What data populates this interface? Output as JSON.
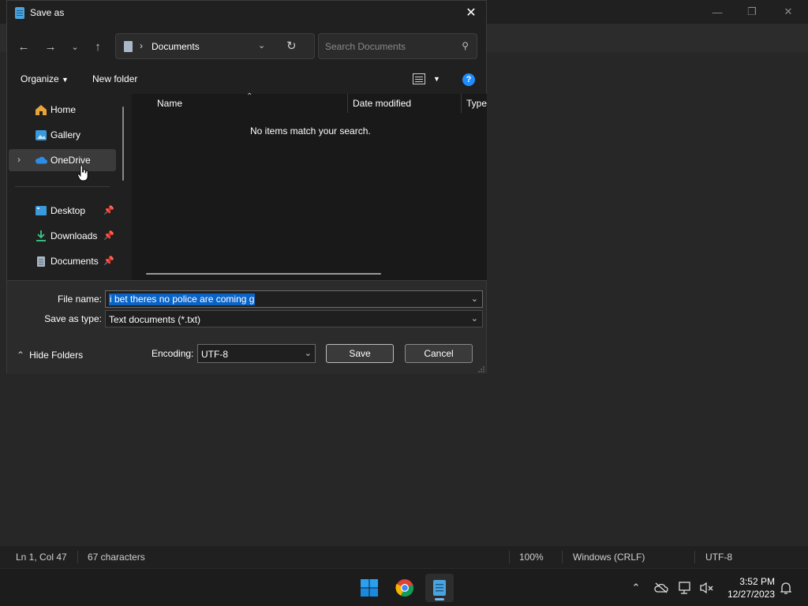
{
  "dialog": {
    "title": "Save as",
    "address": {
      "path": "Documents"
    },
    "search": {
      "placeholder": "Search Documents"
    },
    "commands": {
      "organize": "Organize",
      "new_folder": "New folder",
      "help": "?"
    },
    "nav": [
      {
        "label": "Home",
        "icon": "home-icon"
      },
      {
        "label": "Gallery",
        "icon": "gallery-icon"
      },
      {
        "label": "OneDrive",
        "icon": "onedrive-icon",
        "selected": true
      },
      {
        "label": "Desktop",
        "icon": "desktop-icon",
        "pinned": true
      },
      {
        "label": "Downloads",
        "icon": "downloads-icon",
        "pinned": true
      },
      {
        "label": "Documents",
        "icon": "documents-icon",
        "pinned": true
      }
    ],
    "columns": [
      "Name",
      "Date modified",
      "Type"
    ],
    "empty_message": "No items match your search.",
    "file_name_label": "File name:",
    "file_name_value": "i bet theres no police are coming g",
    "save_type_label": "Save as type:",
    "save_type_value": "Text documents (*.txt)",
    "hide_folders": "Hide Folders",
    "encoding_label": "Encoding:",
    "encoding_value": "UTF-8",
    "save": "Save",
    "cancel": "Cancel"
  },
  "statusbar": {
    "position": "Ln 1, Col 47",
    "characters": "67 characters",
    "zoom": "100%",
    "line_ending": "Windows (CRLF)",
    "encoding": "UTF-8"
  },
  "taskbar": {
    "time": "3:52 PM",
    "date": "12/27/2023"
  },
  "colors": {
    "accent": "#0a64c8",
    "help_blue": "#1e8cff"
  }
}
